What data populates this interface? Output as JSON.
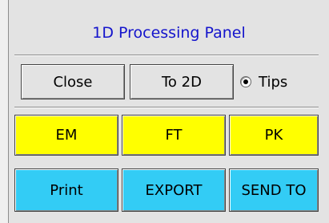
{
  "panel": {
    "title": "1D Processing Panel"
  },
  "controls": {
    "close_label": "Close",
    "to2d_label": "To 2D",
    "tips_label": "Tips",
    "tips_checked": true
  },
  "processing_buttons": {
    "em_label": "EM",
    "ft_label": "FT",
    "pk_label": "PK"
  },
  "output_buttons": {
    "print_label": "Print",
    "export_label": "EXPORT",
    "send_to_label": "SEND TO"
  },
  "colors": {
    "title_text": "#1414cc",
    "processing_buttons_bg": "#ffff00",
    "output_buttons_bg": "#33ccf5",
    "panel_bg": "#e3e3e3"
  }
}
